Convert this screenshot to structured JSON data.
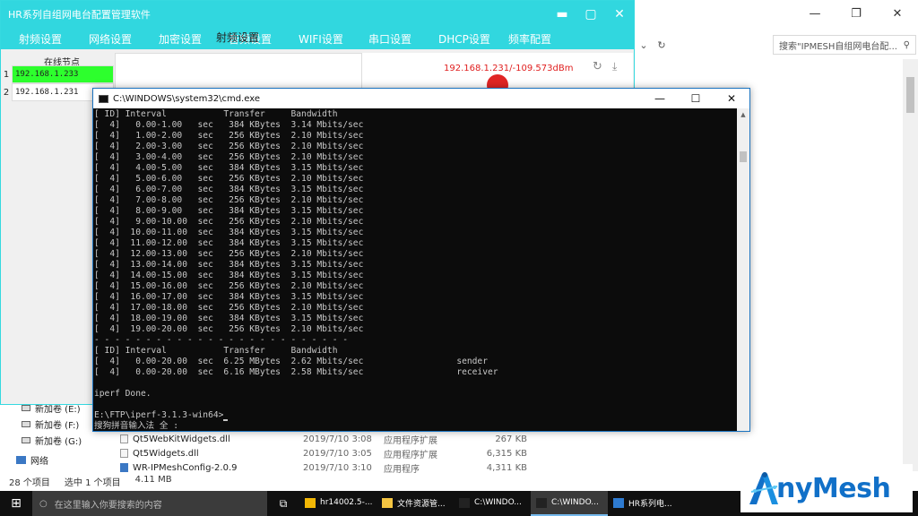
{
  "explorer": {
    "search_placeholder": "搜索\"IPMESH自组网电台配...",
    "nav": [
      {
        "label": "新加卷 (E:)"
      },
      {
        "label": "新加卷 (F:)"
      },
      {
        "label": "新加卷 (G:)"
      }
    ],
    "network_label": "网络",
    "files": [
      {
        "name": "Qt5WebKitWidgets.dll",
        "date": "2019/7/10 3:08",
        "type": "应用程序扩展",
        "size": "267 KB"
      },
      {
        "name": "Qt5Widgets.dll",
        "date": "2019/7/10 3:05",
        "type": "应用程序扩展",
        "size": "6,315 KB"
      },
      {
        "name": "WR-IPMeshConfig-2.0.9",
        "date": "2019/7/10 3:10",
        "type": "应用程序",
        "size": "4,311 KB"
      }
    ],
    "status": {
      "count": "28 个项目",
      "selected": "选中 1 个项目",
      "size": "4.11 MB"
    }
  },
  "hrapp": {
    "title": "HR系列自组网电台配置管理软件",
    "menu": [
      "射频设置",
      "网络设置",
      "加密设置",
      "音频设置",
      "WIFI设置",
      "串口设置",
      "DHCP设置",
      "频率配置"
    ],
    "node_header": "在线节点",
    "nodes": [
      {
        "index": "1",
        "ip": "192.168.1.233"
      },
      {
        "index": "2",
        "ip": "192.168.1.231"
      }
    ],
    "panel_title": "射频设置",
    "signal": "192.168.1.231/-109.573dBm",
    "colors": {
      "accent": "#31d7df",
      "selected_node": "#2dff2d",
      "signal": "#e02020"
    }
  },
  "cmd": {
    "title": "C:\\WINDOWS\\system32\\cmd.exe",
    "lines": [
      "[ ID] Interval           Transfer     Bandwidth",
      "[  4]   0.00-1.00   sec   384 KBytes  3.14 Mbits/sec",
      "[  4]   1.00-2.00   sec   256 KBytes  2.10 Mbits/sec",
      "[  4]   2.00-3.00   sec   256 KBytes  2.10 Mbits/sec",
      "[  4]   3.00-4.00   sec   256 KBytes  2.10 Mbits/sec",
      "[  4]   4.00-5.00   sec   384 KBytes  3.15 Mbits/sec",
      "[  4]   5.00-6.00   sec   256 KBytes  2.10 Mbits/sec",
      "[  4]   6.00-7.00   sec   384 KBytes  3.15 Mbits/sec",
      "[  4]   7.00-8.00   sec   256 KBytes  2.10 Mbits/sec",
      "[  4]   8.00-9.00   sec   384 KBytes  3.15 Mbits/sec",
      "[  4]   9.00-10.00  sec   256 KBytes  2.10 Mbits/sec",
      "[  4]  10.00-11.00  sec   384 KBytes  3.15 Mbits/sec",
      "[  4]  11.00-12.00  sec   384 KBytes  3.15 Mbits/sec",
      "[  4]  12.00-13.00  sec   256 KBytes  2.10 Mbits/sec",
      "[  4]  13.00-14.00  sec   384 KBytes  3.15 Mbits/sec",
      "[  4]  14.00-15.00  sec   384 KBytes  3.15 Mbits/sec",
      "[  4]  15.00-16.00  sec   256 KBytes  2.10 Mbits/sec",
      "[  4]  16.00-17.00  sec   384 KBytes  3.15 Mbits/sec",
      "[  4]  17.00-18.00  sec   256 KBytes  2.10 Mbits/sec",
      "[  4]  18.00-19.00  sec   384 KBytes  3.15 Mbits/sec",
      "[  4]  19.00-20.00  sec   256 KBytes  2.10 Mbits/sec",
      "- - - - - - - - - - - - - - - - - - - - - - - - -",
      "[ ID] Interval           Transfer     Bandwidth",
      "[  4]   0.00-20.00  sec  6.25 MBytes  2.62 Mbits/sec                  sender",
      "[  4]   0.00-20.00  sec  6.16 MBytes  2.58 Mbits/sec                  receiver",
      "",
      "iperf Done.",
      "",
      "E:\\FTP\\iperf-3.1.3-win64>",
      "搜狗拼音输入法 全 :"
    ]
  },
  "taskbar": {
    "search_placeholder": "在这里输入你要搜索的内容",
    "items": [
      {
        "label": "hr14002.5-...",
        "active": false,
        "color": "#f2b705"
      },
      {
        "label": "文件资源管...",
        "active": false,
        "color": "#f4c542"
      },
      {
        "label": "C:\\WINDO...",
        "active": false,
        "color": "#222222"
      },
      {
        "label": "C:\\WINDO...",
        "active": true,
        "color": "#222222"
      },
      {
        "label": "HR系列电...",
        "active": false,
        "color": "#2e7bd1"
      }
    ]
  },
  "logo": {
    "text": "nyMesh",
    "brand_color": "#1170c8"
  }
}
